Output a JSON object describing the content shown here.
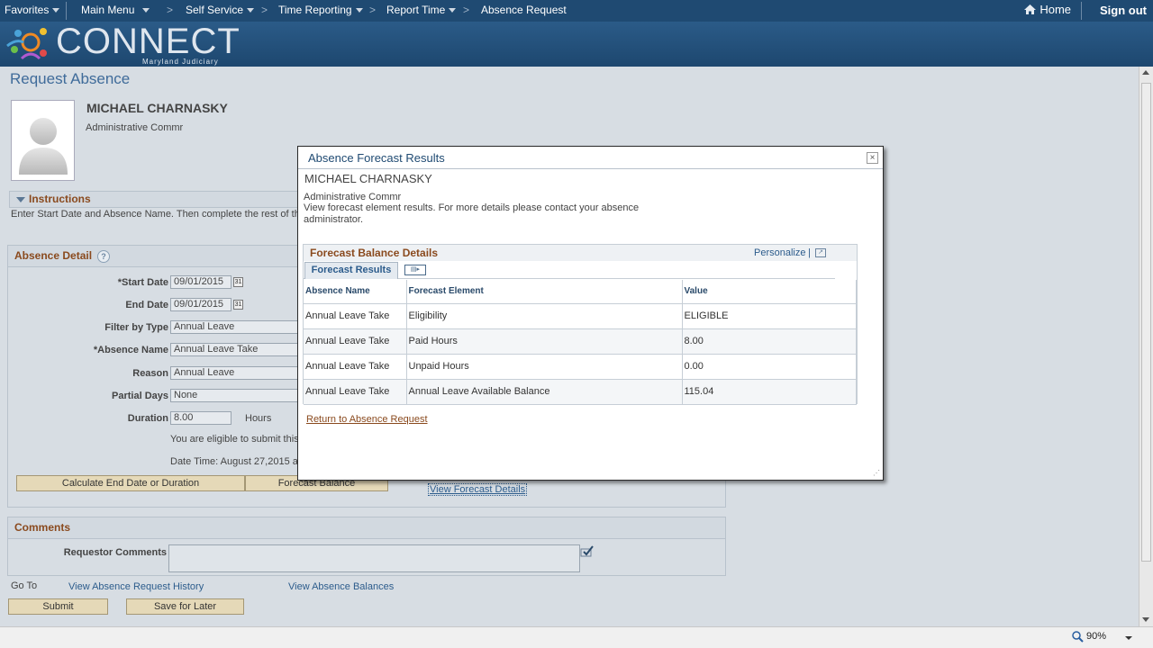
{
  "nav": {
    "favorites": "Favorites",
    "main_menu": "Main Menu",
    "self_service": "Self Service",
    "time_reporting": "Time Reporting",
    "report_time": "Report Time",
    "absence_request": "Absence Request",
    "home": "Home",
    "sign_out": "Sign out"
  },
  "banner": {
    "logo_word": "CONNECT",
    "logo_sub": "Maryland Judiciary"
  },
  "page": {
    "title": "Request Absence",
    "employee_name": "MICHAEL CHARNASKY",
    "employee_title": "Administrative Commr"
  },
  "instructions": {
    "header": "Instructions",
    "text": "Enter Start Date and Absence Name. Then complete the rest of the"
  },
  "absence_detail": {
    "header": "Absence Detail",
    "help": "?",
    "start_date_label": "*Start Date",
    "start_date": "09/01/2015",
    "end_date_label": "End Date",
    "end_date": "09/01/2015",
    "filter_label": "Filter by Type",
    "filter_value": "Annual Leave",
    "absence_name_label": "*Absence Name",
    "absence_name_value": "Annual Leave Take",
    "reason_label": "Reason",
    "reason_value": "Annual Leave",
    "partial_days_label": "Partial Days",
    "partial_days_value": "None",
    "duration_label": "Duration",
    "duration_value": "8.00",
    "duration_unit": "Hours",
    "eligible_text": "You are eligible to submit this",
    "date_time_text": "Date Time: August 27,2015 a",
    "calc_button": "Calculate End Date or Duration",
    "forecast_button": "Forecast Balance",
    "view_forecast_link": "View Forecast Details"
  },
  "comments": {
    "header": "Comments",
    "requestor_label": "Requestor Comments"
  },
  "goto": {
    "label": "Go To",
    "history_link": "View Absence Request History",
    "balances_link": "View Absence Balances"
  },
  "actions": {
    "submit": "Submit",
    "save_later": "Save for Later"
  },
  "status": {
    "zoom": "90%"
  },
  "modal": {
    "title": "Absence Forecast Results",
    "close": "×",
    "name": "MICHAEL CHARNASKY",
    "job_title": "Administrative Commr",
    "description": "View forecast element results. For more details please contact your absence administrator.",
    "grid_title": "Forecast Balance Details",
    "personalize": "Personalize",
    "pipe": "|",
    "tab_label": "Forecast Results",
    "columns": [
      "Absence Name",
      "Forecast Element",
      "Value"
    ],
    "rows": [
      [
        "Annual Leave Take",
        "Eligibility",
        "ELIGIBLE"
      ],
      [
        "Annual Leave Take",
        "Paid Hours",
        "8.00"
      ],
      [
        "Annual Leave Take",
        "Unpaid Hours",
        "0.00"
      ],
      [
        "Annual Leave Take",
        "Annual Leave Available Balance",
        "115.04"
      ]
    ],
    "return_link": "Return to Absence Request"
  },
  "colors": {
    "nav_bg": "#1f4a72",
    "section_header_text": "#8a4a1e",
    "link": "#2c5c8c",
    "button_bg": "#e5d9b8"
  }
}
